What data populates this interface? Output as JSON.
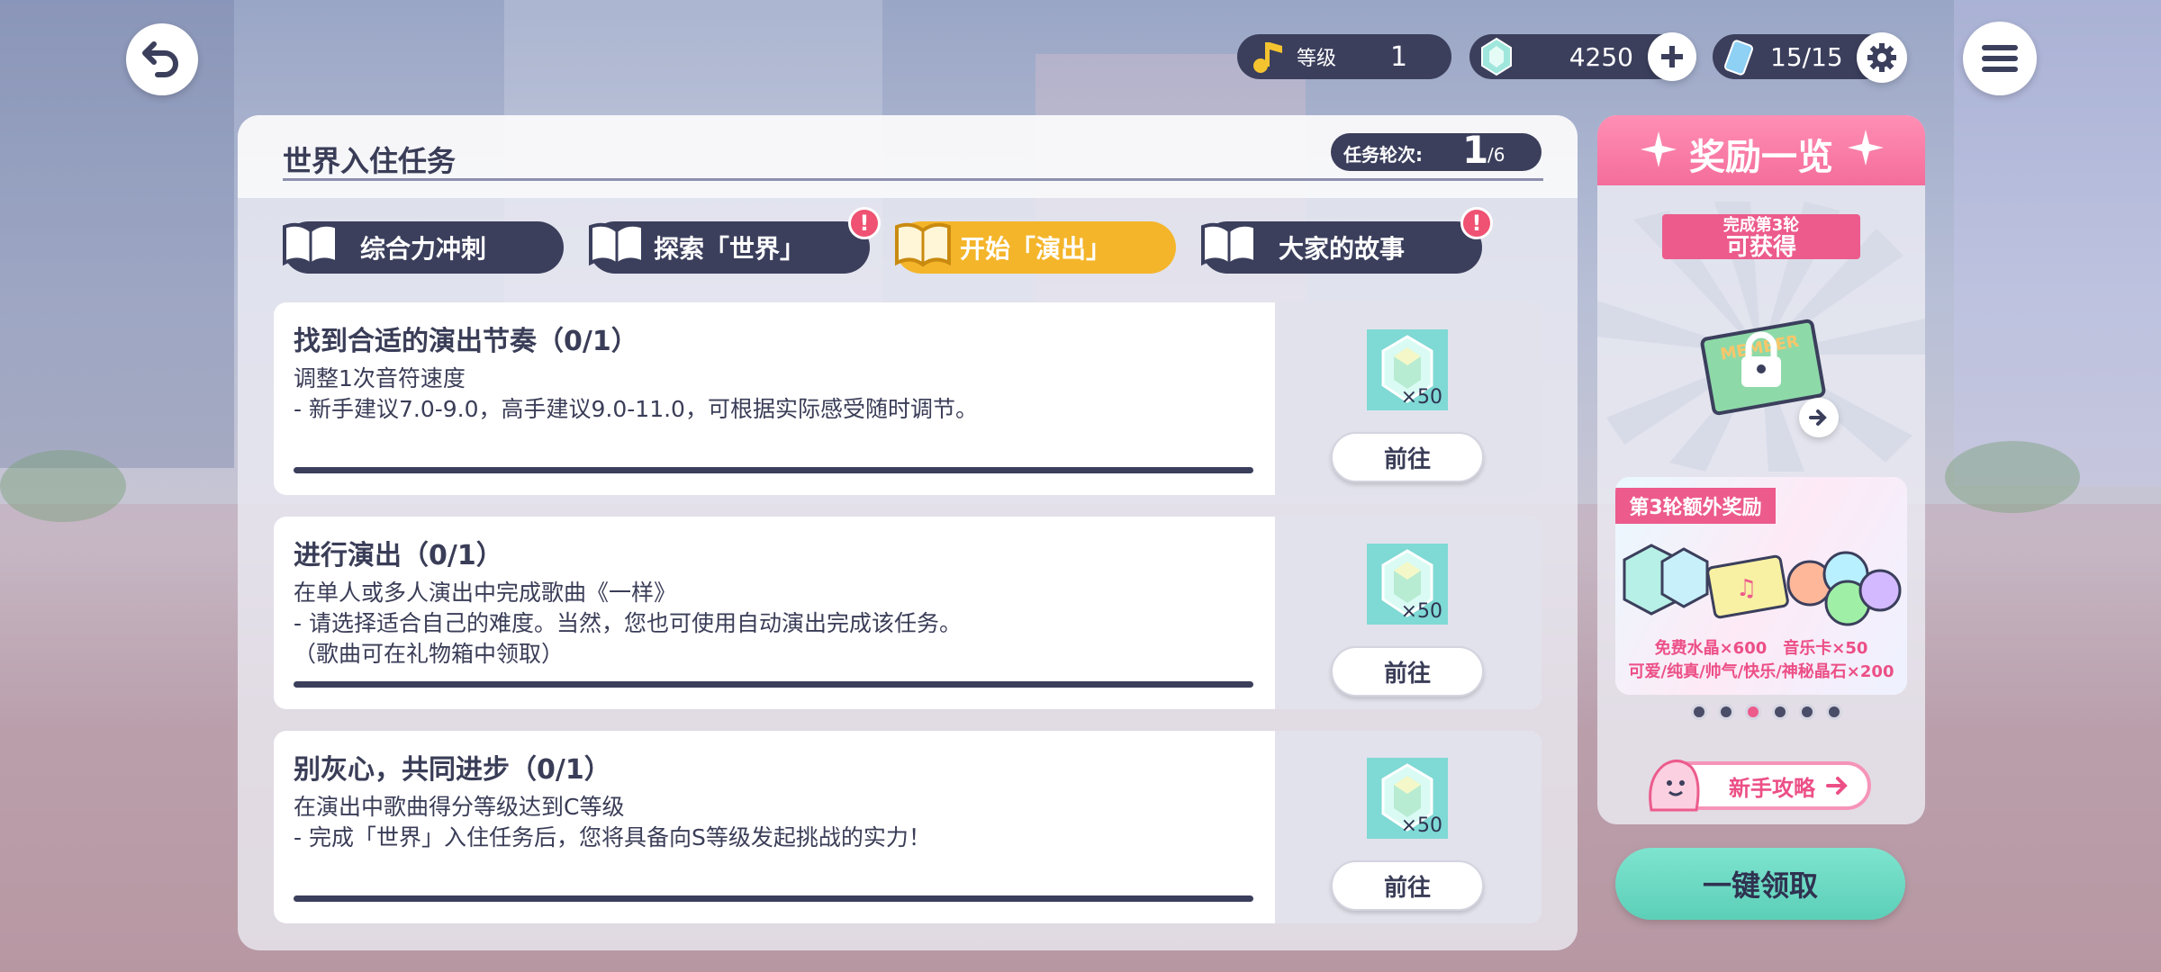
{
  "header": {
    "level_label": "等级",
    "level_value": "1",
    "crystal_value": "4250",
    "stamina_value": "15/15"
  },
  "panel": {
    "title": "世界入住任务",
    "round_label": "任务轮次:",
    "round_current": "1",
    "round_total": "/6"
  },
  "tabs": [
    {
      "label": "综合力冲刺",
      "active": false,
      "alert": false
    },
    {
      "label": "探索「世界」",
      "active": false,
      "alert": true
    },
    {
      "label": "开始「演出」",
      "active": true,
      "alert": false
    },
    {
      "label": "大家的故事",
      "active": false,
      "alert": true
    }
  ],
  "alert_mark": "!",
  "tasks": [
    {
      "title": "找到合适的演出节奏（0/1）",
      "desc": "调整1次音符速度\n- 新手建议7.0-9.0，高手建议9.0-11.0，可根据实际感受随时调节。",
      "reward_count": "×50",
      "button": "前往"
    },
    {
      "title": "进行演出（0/1）",
      "desc": "在单人或多人演出中完成歌曲《一样》\n- 请选择适合自己的难度。当然，您也可使用自动演出完成该任务。\n（歌曲可在礼物箱中领取）",
      "reward_count": "×50",
      "button": "前往"
    },
    {
      "title": "别灰心，共同进步（0/1）",
      "desc": "在演出中歌曲得分等级达到C等级\n- 完成「世界」入住任务后，您将具备向S等级发起挑战的实力！",
      "reward_count": "×50",
      "button": "前往"
    }
  ],
  "side": {
    "title": "奖励一览",
    "ribbon_sub": "完成第3轮",
    "ribbon_main": "可获得",
    "card_text": "MEMBER",
    "bonus_tag": "第3轮额外奖励",
    "bonus_line1": "免费水晶×600　音乐卡×50",
    "bonus_line2": "可爱/纯真/帅气/快乐/神秘晶石×200",
    "guide_label": "新手攻略",
    "page_dots": 6,
    "active_dot": 3
  },
  "claim_all": "一键领取",
  "colors": {
    "navy": "#3b3f5c",
    "active_tab": "#f4b52a",
    "pink": "#ec5b8c",
    "mint": "#6ed9c3",
    "crystal_bg": "#7fd9d4"
  }
}
